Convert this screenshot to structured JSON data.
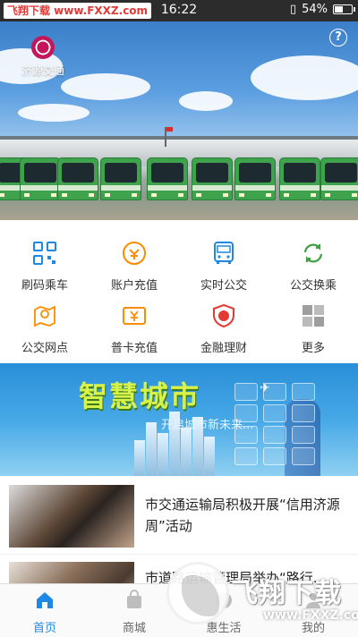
{
  "status_bar": {
    "watermark": "飞翔下载 www.FXXZ.com",
    "time": "16:22",
    "battery": "54%",
    "battery_level": 0.54
  },
  "hero": {
    "logo_text": "济源交通",
    "help_label": "?"
  },
  "services": [
    {
      "label": "刷码乘车",
      "icon": "qr-scan-icon",
      "color": "#1e88e5"
    },
    {
      "label": "账户充值",
      "icon": "coin-icon",
      "color": "#fb8c00"
    },
    {
      "label": "实时公交",
      "icon": "bus-icon",
      "color": "#1e88e5"
    },
    {
      "label": "公交换乘",
      "icon": "transfer-icon",
      "color": "#43a047"
    },
    {
      "label": "公交网点",
      "icon": "map-pin-icon",
      "color": "#fb8c00"
    },
    {
      "label": "普卡充值",
      "icon": "card-yen-icon",
      "color": "#fb8c00"
    },
    {
      "label": "金融理财",
      "icon": "finance-shield-icon",
      "color": "#e53935"
    },
    {
      "label": "更多",
      "icon": "more-grid-icon",
      "color": "#9e9e9e"
    }
  ],
  "banner": {
    "title": "智慧城市",
    "subtitle": "开启城市新未来..."
  },
  "news": [
    {
      "title": "市交通运输局积极开展“信用济源周”活动"
    },
    {
      "title": "市道路运输管理局举办“路行..."
    }
  ],
  "tabs": [
    {
      "label": "首页",
      "icon": "home-icon",
      "active": true
    },
    {
      "label": "商城",
      "icon": "shop-bag-icon",
      "active": false
    },
    {
      "label": "惠生活",
      "icon": "life-icon",
      "active": false
    },
    {
      "label": "我的",
      "icon": "user-icon",
      "active": false
    }
  ],
  "overlay_watermark": {
    "text": "飞翔下载",
    "url": "www.FXXZ.com"
  }
}
